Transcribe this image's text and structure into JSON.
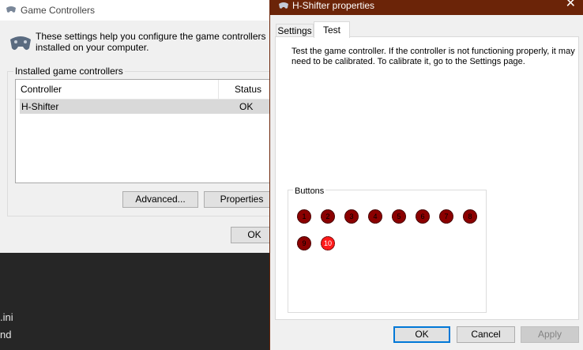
{
  "background": {
    "line1": ".ini",
    "line2": "nd"
  },
  "game_controllers": {
    "title": "Game Controllers",
    "description": "These settings help you configure the game controllers installed on your computer.",
    "group_label": "Installed game controllers",
    "columns": [
      "Controller",
      "Status"
    ],
    "rows": [
      {
        "controller": "H-Shifter",
        "status": "OK"
      }
    ],
    "advanced_button": "Advanced...",
    "properties_button": "Properties",
    "ok_button": "OK"
  },
  "properties_dialog": {
    "title": "H-Shifter properties",
    "tabs": [
      "Settings",
      "Test"
    ],
    "active_tab": "Test",
    "description": "Test the game controller.  If the controller is not functioning properly, it may need to be calibrated.  To calibrate it, go to the Settings page.",
    "buttons_label": "Buttons",
    "button_numbers": [
      "1",
      "2",
      "3",
      "4",
      "5",
      "6",
      "7",
      "8",
      "9",
      "10"
    ],
    "pressed_button": "10",
    "ok_button": "OK",
    "cancel_button": "Cancel",
    "apply_button": "Apply"
  },
  "colors": {
    "titlebar_active": "#6b2408",
    "button_idle": "#8b0000",
    "button_pressed": "#ff1a1a"
  }
}
